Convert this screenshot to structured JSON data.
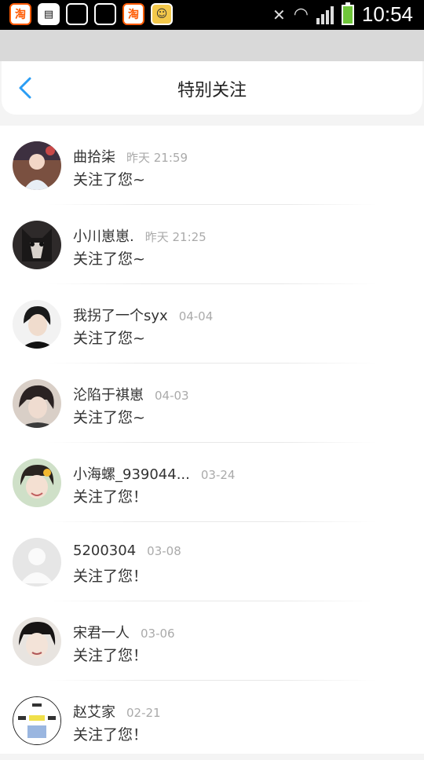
{
  "status_bar": {
    "time": "10:54",
    "apps": [
      "taobao-icon",
      "document-icon",
      "sd-card-icon",
      "image-icon",
      "taobao-icon",
      "qq-icon"
    ],
    "battery_color": "#6fc63a"
  },
  "header": {
    "title": "特别关注",
    "accent": "#2a9df4"
  },
  "notifications": [
    {
      "name": "曲拾柒",
      "date": "昨天 21:59",
      "message": "关注了您~",
      "avatar": "photo"
    },
    {
      "name": "小川崽崽.",
      "date": "昨天 21:25",
      "message": "关注了您~",
      "avatar": "photo"
    },
    {
      "name": "我拐了一个syx",
      "date": "04-04",
      "message": "关注了您~",
      "avatar": "photo"
    },
    {
      "name": "沦陷于褀崽",
      "date": "04-03",
      "message": "关注了您~",
      "avatar": "photo"
    },
    {
      "name": "小海螺_939044...",
      "date": "03-24",
      "message": "关注了您！",
      "avatar": "photo"
    },
    {
      "name": "5200304",
      "date": "03-08",
      "message": "关注了您！",
      "avatar": "default"
    },
    {
      "name": "宋君一人",
      "date": "03-06",
      "message": "关注了您！",
      "avatar": "photo"
    },
    {
      "name": "赵艾家",
      "date": "02-21",
      "message": "关注了您！",
      "avatar": "photo"
    }
  ]
}
